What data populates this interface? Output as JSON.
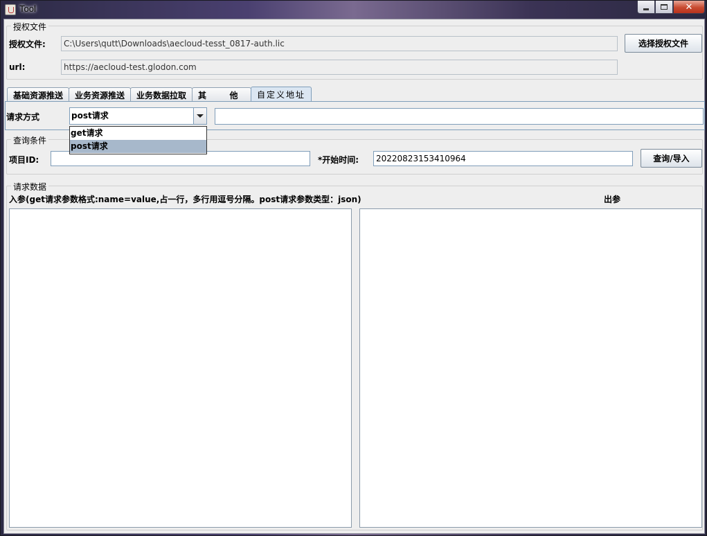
{
  "window": {
    "title": "Tool"
  },
  "license_group": {
    "title": "授权文件",
    "file_label": "授权文件:",
    "file_value": "C:\\Users\\qutt\\Downloads\\aecloud-tesst_0817-auth.lic",
    "select_button": "选择授权文件",
    "url_label": "url:",
    "url_value": "https://aecloud-test.glodon.com"
  },
  "tabs": [
    {
      "label": "基础资源推送"
    },
    {
      "label": "业务资源推送"
    },
    {
      "label": "业务数据拉取"
    },
    {
      "label": "其        他"
    },
    {
      "label": "自定义地址",
      "active": true
    }
  ],
  "request": {
    "method_label": "请求方式",
    "method_selected": "post请求",
    "options": [
      "get请求",
      "post请求"
    ],
    "selected_index": 1,
    "url_value": ""
  },
  "query_group": {
    "title": "查询条件",
    "project_id_label": "项目ID:",
    "project_id_value": "",
    "start_time_label": "*开始时间:",
    "start_time_value": "20220823153410964",
    "query_button": "查询/导入"
  },
  "data_group": {
    "title": "请求数据",
    "input_label": "入参(get请求参数格式:name=value,占一行，多行用逗号分隔。post请求参数类型：json)",
    "output_label": "出参"
  }
}
